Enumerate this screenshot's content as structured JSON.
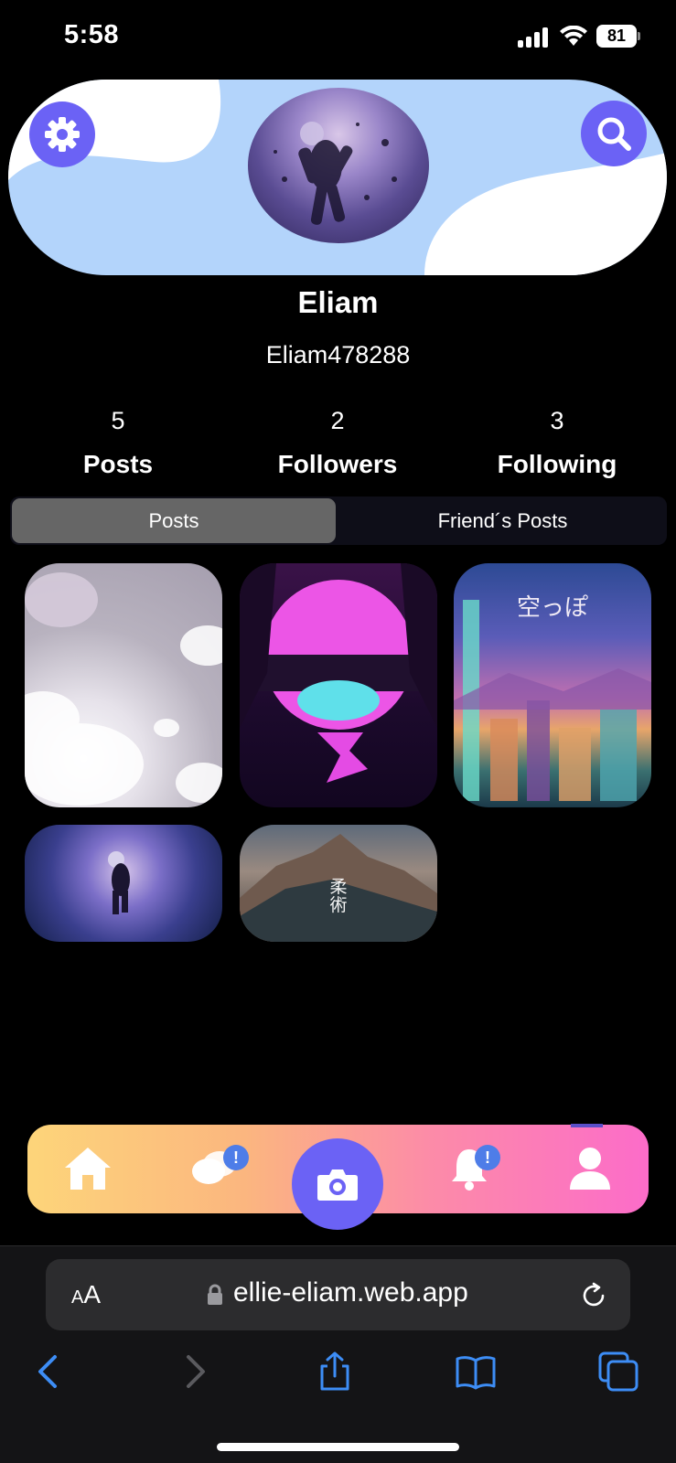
{
  "status_bar": {
    "time": "5:58",
    "battery": "81"
  },
  "profile": {
    "display_name": "Eliam",
    "username": "Eliam478288",
    "avatar_icon": "astronaut-avatar"
  },
  "stats": [
    {
      "value": "5",
      "label": "Posts"
    },
    {
      "value": "2",
      "label": "Followers"
    },
    {
      "value": "3",
      "label": "Following"
    }
  ],
  "tabs": [
    {
      "label": "Posts",
      "active": true
    },
    {
      "label": "Friend´s Posts",
      "active": false
    }
  ],
  "posts": [
    {
      "theme": "cloudy-sky"
    },
    {
      "theme": "synthwave-sunset"
    },
    {
      "theme": "pixel-city",
      "caption": "空っぽ"
    },
    {
      "theme": "astronaut-nebula"
    },
    {
      "theme": "mountain-kanji",
      "caption": "柔術"
    }
  ],
  "nav": {
    "items": [
      "home-icon",
      "chat-icon",
      "camera-icon",
      "bell-icon",
      "user-icon"
    ],
    "badge_symbol": "!",
    "accent": "#6b62f5",
    "badge_color": "#4e7de8"
  },
  "browser": {
    "text_size_label_small": "A",
    "text_size_label_large": "A",
    "url": "ellie-eliam.web.app"
  },
  "colors": {
    "banner": "#b3d4fb",
    "button_accent": "#6b62f5",
    "active_tab": "#666666"
  }
}
